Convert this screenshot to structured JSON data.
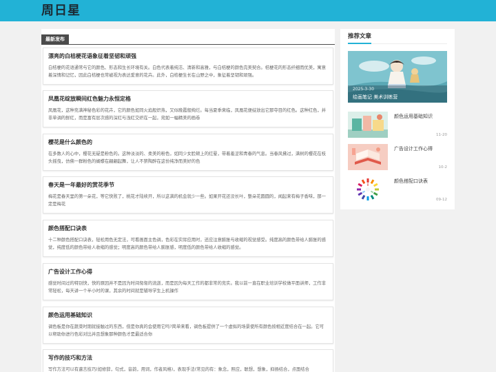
{
  "site": {
    "title": "周日星"
  },
  "main": {
    "section_label": "最新发布",
    "articles": [
      {
        "title": "漂亮的白桔梗花语象征着坚韧和顽强",
        "summary": "白桔梗的花语通常与它的颜色、形态和生长环境有关。白色代表着纯洁、清新和高雅，与白桔梗的颜色完美契合。桔梗花的形态纤细而优美，寓意着深情和记忆，因此白桔梗也常被视为表达爱意的花卉。此外，白桔梗生长在山野之中，象征着坚韧和顽强。"
      },
      {
        "title": "凤凰花绽放瞬间红色魅力永恒定格",
        "summary": "凤凰花，这种充满神秘色彩的花卉，它的颜色如同火焰般炽热，又似晚霞般绚烂。每当夏季来临，凤凰花便绽放出它那夺目的红色。这种红色，并非单调的鲜红，而是富有层次感的深红与浅红交织在一起，宛如一幅精美的画卷"
      },
      {
        "title": "樱花是什么颜色的",
        "summary": "在多数人的心中，樱花无疑是粉色的。这种淡淡的、柔美的粉色，如同少女脸颊上的红晕，带着羞涩和青春的气息。当春风拂过，满树的樱花在枝头摇曳，仿佛一群粉色的蝴蝶在翩翩起舞，让人不禁陶醉在这份纯净而美好的色"
      },
      {
        "title": "春天是一年最好的赏花季节",
        "summary": "梅花是春天里的第一朵花，等它快败了，桃花才陆续开，所以这满的机会就少一些。如果开花还没长叶，整朵花圆圆的，闻起来有梅子香味，那一定是梅花"
      },
      {
        "title": "颜色搭配口诀表",
        "summary": "十二种颜色搭配口诀表，轻松用色无定法，可看画面主色调，色彩在实际应用时，还应注意膨胀与收缩的视觉感受。纯度高的颜色带给人膨胀的感觉，纯度低的颜色带给人收缩的感觉；明度高的颜色带给人膨胀感，明度低的颜色带给人收缩的感觉。"
      },
      {
        "title": "广告设计工作心得",
        "summary": "感觉时间过的特别快，快的原因并不是因为时间匆匆的流逝，而是因为每天工作的都非常的充实。我以前一直在职业培训学校做平面讲师，工作非常轻松，每天讲一个半小时的课，其余的时间就是辅导学生上机操作"
      },
      {
        "title": "颜色运用基础知识",
        "summary": "调色板是你在蔬菜时期就接触过的东西，但是你真的会使用它吗?简单来看，调色板提供了一个虚拟的场景使所有颜色按相近度结合在一起。它可以帮助你进行色彩对比并且想象那种颜色才是最适合你"
      },
      {
        "title": "写作的技巧和方法",
        "summary": "写作方法可以有遣言技巧(如修辞，句式，音韵，用词，作者风格)，表现手法(常见的有：象念，照应，联想，想象，抑扬结合，点面结合"
      }
    ]
  },
  "sidebar": {
    "title": "推荐文章",
    "featured": {
      "date": "2025-3-30",
      "title": "绘画笔记 美术训练营"
    },
    "items": [
      {
        "title": "颜色运用基础知识",
        "date": "11-20",
        "thumb_icon": "palette-illustration"
      },
      {
        "title": "广告设计工作心得",
        "date": "10-2",
        "thumb_icon": "open-book-illustration"
      },
      {
        "title": "颜色搭配口诀表",
        "date": "09-12",
        "thumb_icon": "color-wheel-illustration"
      }
    ]
  },
  "colors": {
    "header": "#22b2d6",
    "accent": "#22b2d6",
    "tag": "#4b4b4b"
  }
}
